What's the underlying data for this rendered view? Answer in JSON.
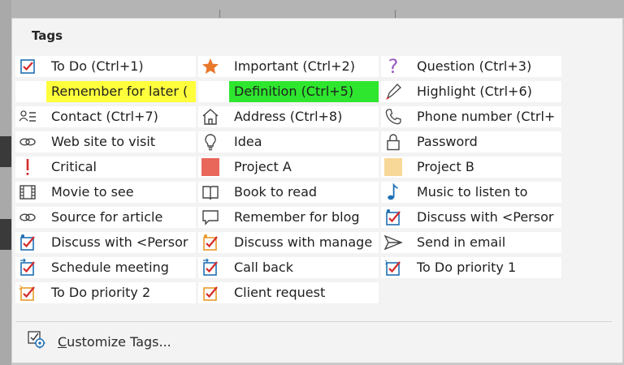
{
  "panel": {
    "title": "Tags"
  },
  "tags": [
    {
      "name": "tag-to-do",
      "label": "To Do (Ctrl+1)",
      "icon": "checkbox-check-icon"
    },
    {
      "name": "tag-important",
      "label": "Important (Ctrl+2)",
      "icon": "star-icon"
    },
    {
      "name": "tag-question",
      "label": "Question (Ctrl+3)",
      "icon": "question-mark-icon"
    },
    {
      "name": "tag-remember-for-later",
      "label": "Remember for later (",
      "icon": "none",
      "highlight": "yellow"
    },
    {
      "name": "tag-definition",
      "label": "Definition (Ctrl+5)",
      "icon": "none",
      "highlight": "green"
    },
    {
      "name": "tag-highlight",
      "label": "Highlight (Ctrl+6)",
      "icon": "highlighter-pen-icon"
    },
    {
      "name": "tag-contact",
      "label": "Contact (Ctrl+7)",
      "icon": "contact-card-icon"
    },
    {
      "name": "tag-address",
      "label": "Address (Ctrl+8)",
      "icon": "house-icon"
    },
    {
      "name": "tag-phone-number",
      "label": "Phone number (Ctrl+",
      "icon": "phone-icon"
    },
    {
      "name": "tag-web-site-to-visit",
      "label": "Web site to visit",
      "icon": "link-icon"
    },
    {
      "name": "tag-idea",
      "label": "Idea",
      "icon": "lightbulb-icon"
    },
    {
      "name": "tag-password",
      "label": "Password",
      "icon": "padlock-icon"
    },
    {
      "name": "tag-critical",
      "label": "Critical",
      "icon": "exclamation-icon"
    },
    {
      "name": "tag-project-a",
      "label": "Project A",
      "icon": "red-square-icon"
    },
    {
      "name": "tag-project-b",
      "label": "Project B",
      "icon": "yellow-square-icon"
    },
    {
      "name": "tag-movie-to-see",
      "label": "Movie to see",
      "icon": "film-icon"
    },
    {
      "name": "tag-book-to-read",
      "label": "Book to read",
      "icon": "book-icon"
    },
    {
      "name": "tag-music-to-listen-to",
      "label": "Music to listen to",
      "icon": "music-note-icon"
    },
    {
      "name": "tag-source-for-article",
      "label": "Source for article",
      "icon": "link-icon"
    },
    {
      "name": "tag-remember-for-blog",
      "label": "Remember for blog",
      "icon": "speech-bubble-icon"
    },
    {
      "name": "tag-discuss-with-person-a",
      "label": "Discuss with <Persor",
      "icon": "checkbox-person-a-icon"
    },
    {
      "name": "tag-discuss-with-person-b",
      "label": "Discuss with <Persor",
      "icon": "checkbox-person-b-icon"
    },
    {
      "name": "tag-discuss-with-manager",
      "label": "Discuss with manage",
      "icon": "checkbox-manager-icon"
    },
    {
      "name": "tag-send-in-email",
      "label": "Send in email",
      "icon": "send-arrow-icon"
    },
    {
      "name": "tag-schedule-meeting",
      "label": "Schedule meeting",
      "icon": "checkbox-arrow-icon"
    },
    {
      "name": "tag-call-back",
      "label": "Call back",
      "icon": "checkbox-arrow-icon"
    },
    {
      "name": "tag-to-do-priority-1",
      "label": "To Do priority 1",
      "icon": "checkbox-priority-1-icon"
    },
    {
      "name": "tag-to-do-priority-2",
      "label": "To Do priority 2",
      "icon": "checkbox-priority-2-icon"
    },
    {
      "name": "tag-client-request",
      "label": "Client request",
      "icon": "checkbox-client-icon"
    }
  ],
  "footer": {
    "customize_prefix": "C",
    "customize_rest": "ustomize Tags...",
    "icon": "customize-tags-icon"
  },
  "colors": {
    "check_red": "#d42a2a",
    "box_blue": "#1f6fb3",
    "star_orange": "#e8782a",
    "question_purple": "#9b59c0",
    "project_a": "#e8665a",
    "project_b": "#f8d898",
    "box_orange": "#e89a2a"
  }
}
